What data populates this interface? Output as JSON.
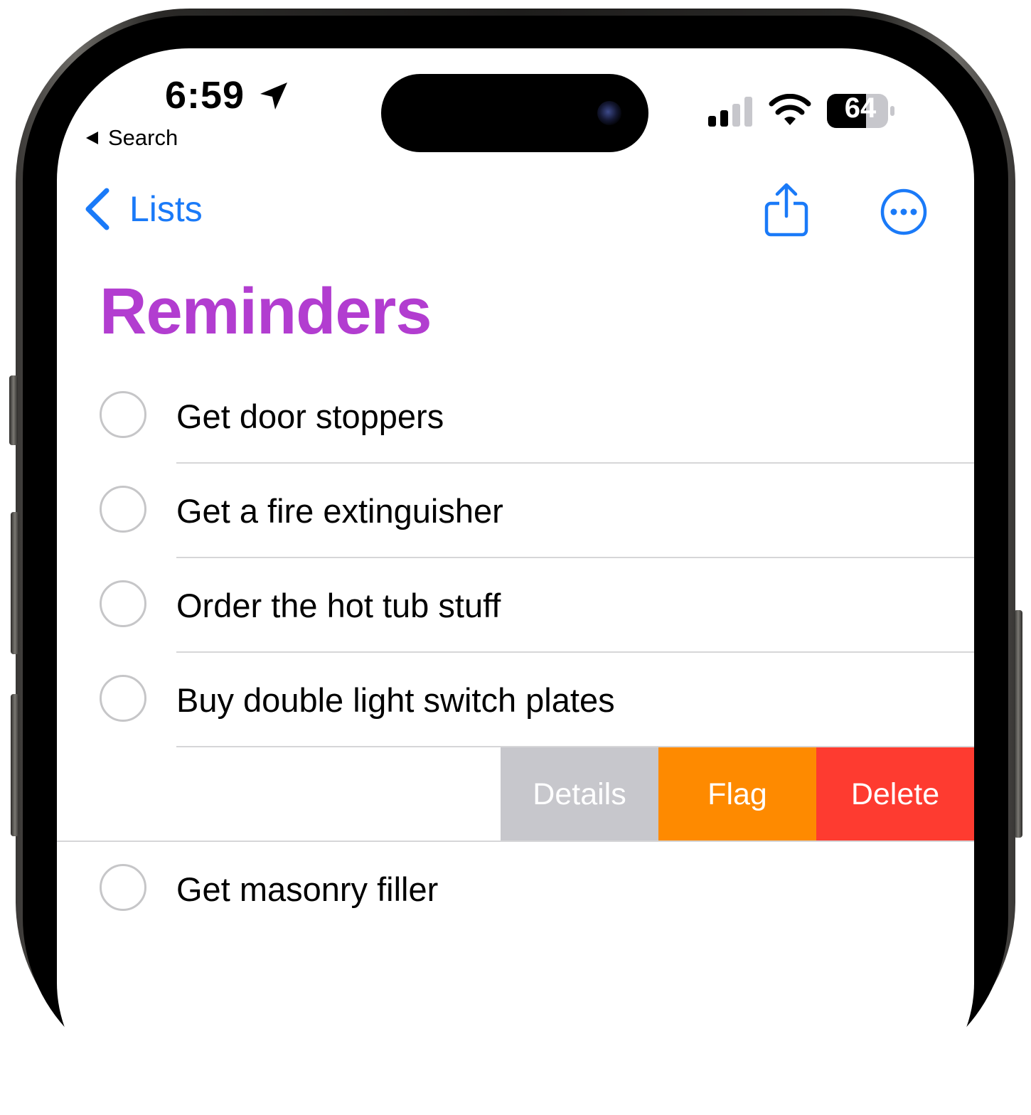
{
  "status_bar": {
    "time": "6:59",
    "back_app_label": "Search",
    "battery_level": "64",
    "icons": [
      "location-arrow-icon",
      "cellular-signal-icon",
      "wifi-icon",
      "battery-icon"
    ]
  },
  "nav": {
    "back_label": "Lists",
    "share_icon": "share-icon",
    "more_icon": "ellipsis-circle-icon"
  },
  "list": {
    "title": "Reminders",
    "title_color": "#b23dd0",
    "items": [
      {
        "label": "Get door stoppers",
        "completed": false
      },
      {
        "label": "Get a fire extinguisher",
        "completed": false
      },
      {
        "label": "Order the hot tub stuff",
        "completed": false
      },
      {
        "label": "Buy double light switch plates",
        "completed": false
      },
      {
        "label": "Get masonry filler",
        "completed": false
      }
    ]
  },
  "swipe_actions": {
    "details_label": "Details",
    "flag_label": "Flag",
    "delete_label": "Delete",
    "details_color": "#c7c7cc",
    "flag_color": "#fe8a00",
    "delete_color": "#fe3b30"
  },
  "accent_color": "#1a7af8"
}
